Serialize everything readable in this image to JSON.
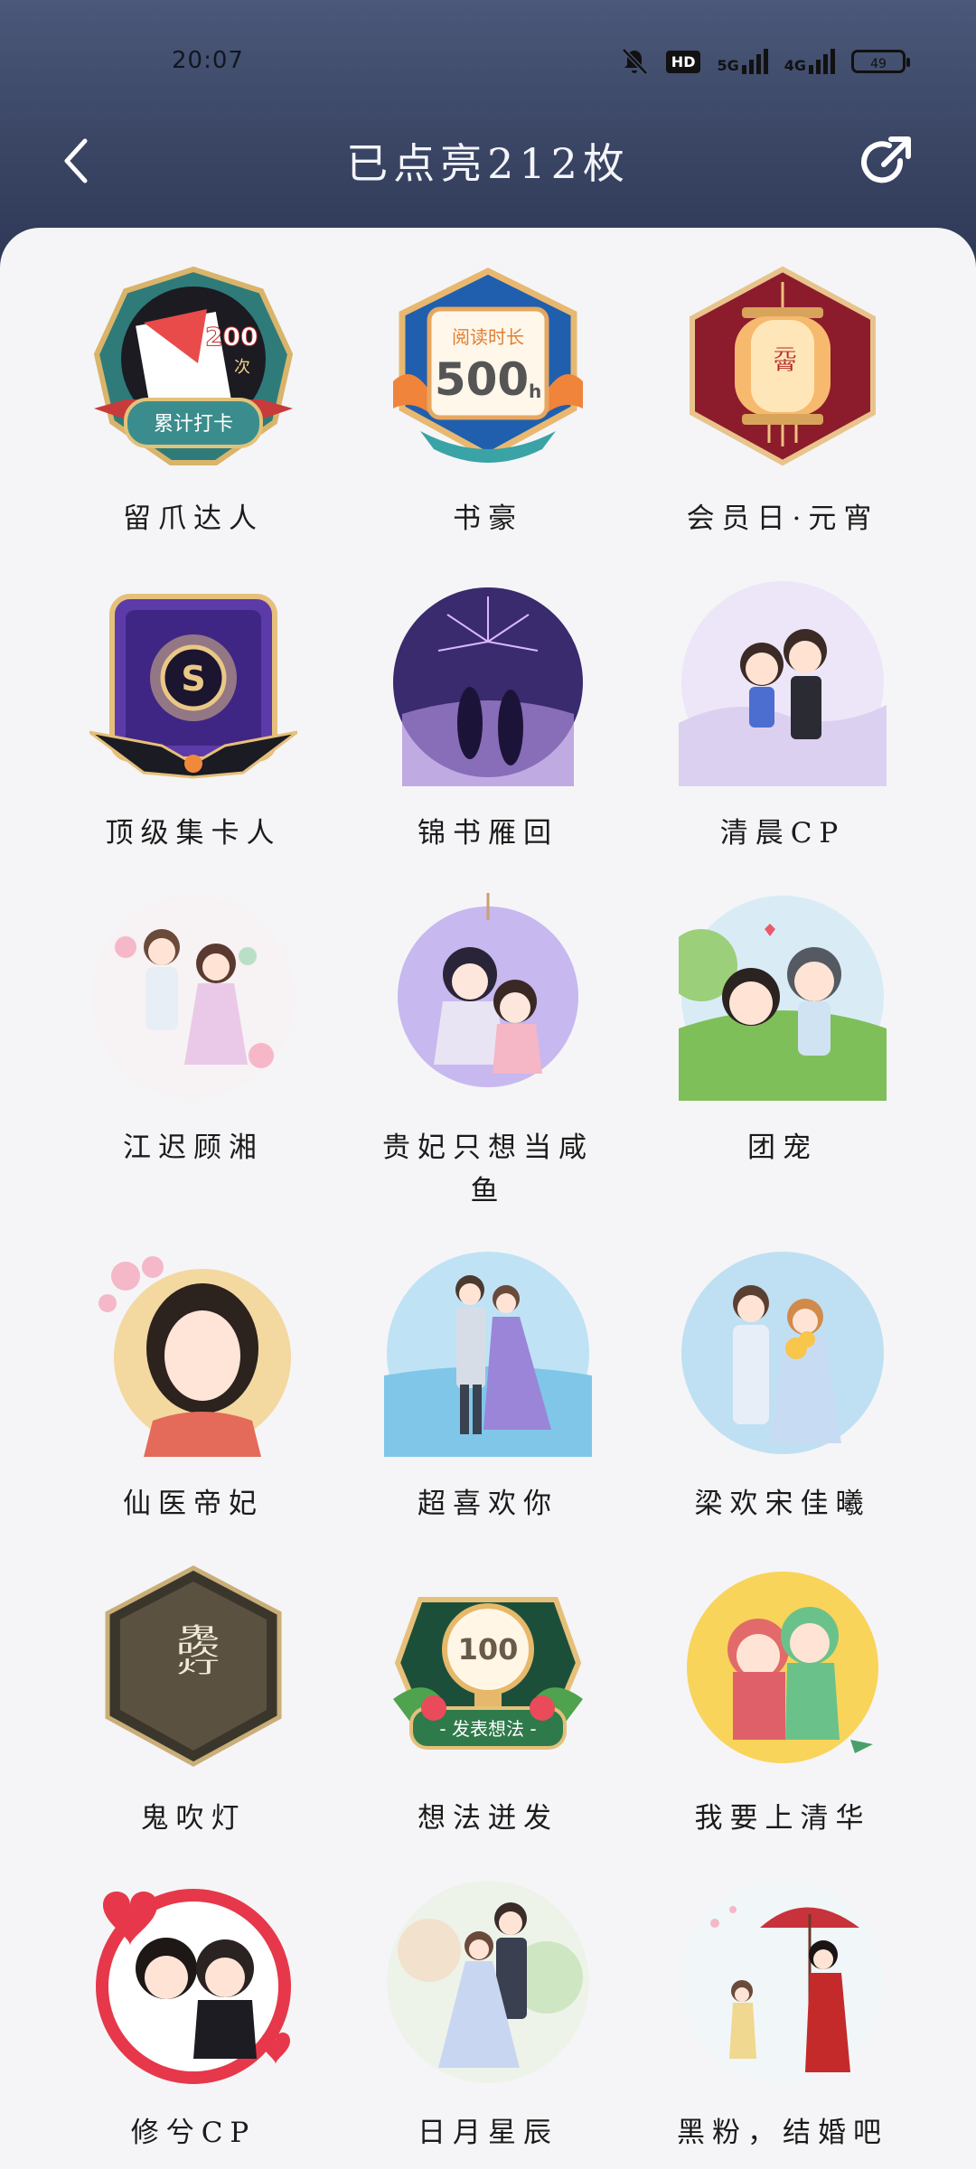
{
  "status": {
    "time": "20:07",
    "hd": "HD",
    "sig1": "5G",
    "sig2": "4G",
    "battery": "49"
  },
  "header": {
    "title": "已点亮212枚"
  },
  "badges": [
    {
      "name": "留爪达人",
      "icon": "paw-checkin-badge-icon",
      "big": "200",
      "sub": "次",
      "ribbon": "累计打卡"
    },
    {
      "name": "书豪",
      "icon": "reading-time-badge-icon",
      "big": "500",
      "sub": "h",
      "ribbon": "阅读时长"
    },
    {
      "name": "会员日·元宵",
      "icon": "lantern-badge-icon",
      "big": "元宵"
    },
    {
      "name": "顶级集卡人",
      "icon": "card-collector-badge-icon",
      "big": "S"
    },
    {
      "name": "锦书雁回",
      "icon": "fireworks-couple-icon"
    },
    {
      "name": "清晨CP",
      "icon": "chibi-couple-icon"
    },
    {
      "name": "江迟顾湘",
      "icon": "couple-illustration-icon"
    },
    {
      "name": "贵妃只想当咸鱼",
      "icon": "ancient-couple-icon"
    },
    {
      "name": "团宠",
      "icon": "cat-ear-kids-icon"
    },
    {
      "name": "仙医帝妃",
      "icon": "ancient-lady-portrait-icon"
    },
    {
      "name": "超喜欢你",
      "icon": "seaside-couple-icon"
    },
    {
      "name": "梁欢宋佳曦",
      "icon": "flower-couple-icon"
    },
    {
      "name": "鬼吹灯",
      "icon": "ghost-lamp-book-icon",
      "big": "鬼吹灯"
    },
    {
      "name": "想法迸发",
      "icon": "idea-bulb-badge-icon",
      "big": "100",
      "ribbon": "- 发表想法 -"
    },
    {
      "name": "我要上清华",
      "icon": "dino-costume-kids-icon"
    },
    {
      "name": "修兮CP",
      "icon": "heart-couple-icon"
    },
    {
      "name": "日月星辰",
      "icon": "garden-couple-icon"
    },
    {
      "name": "黑粉，结婚吧",
      "icon": "umbrella-couple-icon"
    }
  ]
}
